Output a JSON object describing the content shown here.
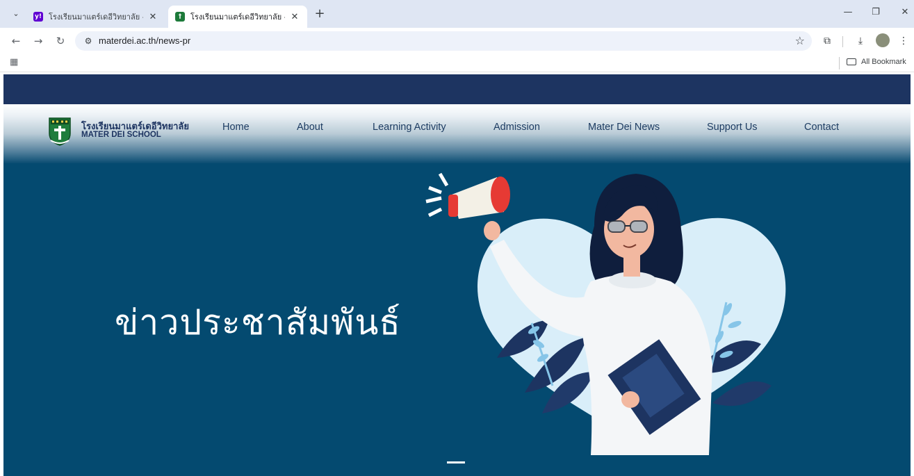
{
  "browser": {
    "tabs": [
      {
        "title": "โรงเรียนมาแตร์เดอีวิทยาลัย - Yahoo",
        "favicon": "yahoo-icon",
        "active": false
      },
      {
        "title": "โรงเรียนมาแตร์เดอีวิทยาลัย - อบรมเ",
        "favicon": "school-crest-icon",
        "active": true
      }
    ],
    "url": "materdei.ac.th/news-pr",
    "bookmarks_label": "All Bookmark"
  },
  "site": {
    "logo_th": "โรงเรียนมาแตร์เดอีวิทยาลัย",
    "logo_en": "MATER DEI SCHOOL",
    "nav": [
      "Home",
      "About",
      "Learning Activity",
      "Admission",
      "Mater Dei News",
      "Support Us",
      "Contact"
    ],
    "hero_title": "ข่าวประชาสัมพันธ์"
  },
  "colors": {
    "topbar": "#1d3461",
    "hero_background": "#044a70",
    "nav_text": "#1d3c62",
    "tabstrip": "#dfe6f3"
  }
}
